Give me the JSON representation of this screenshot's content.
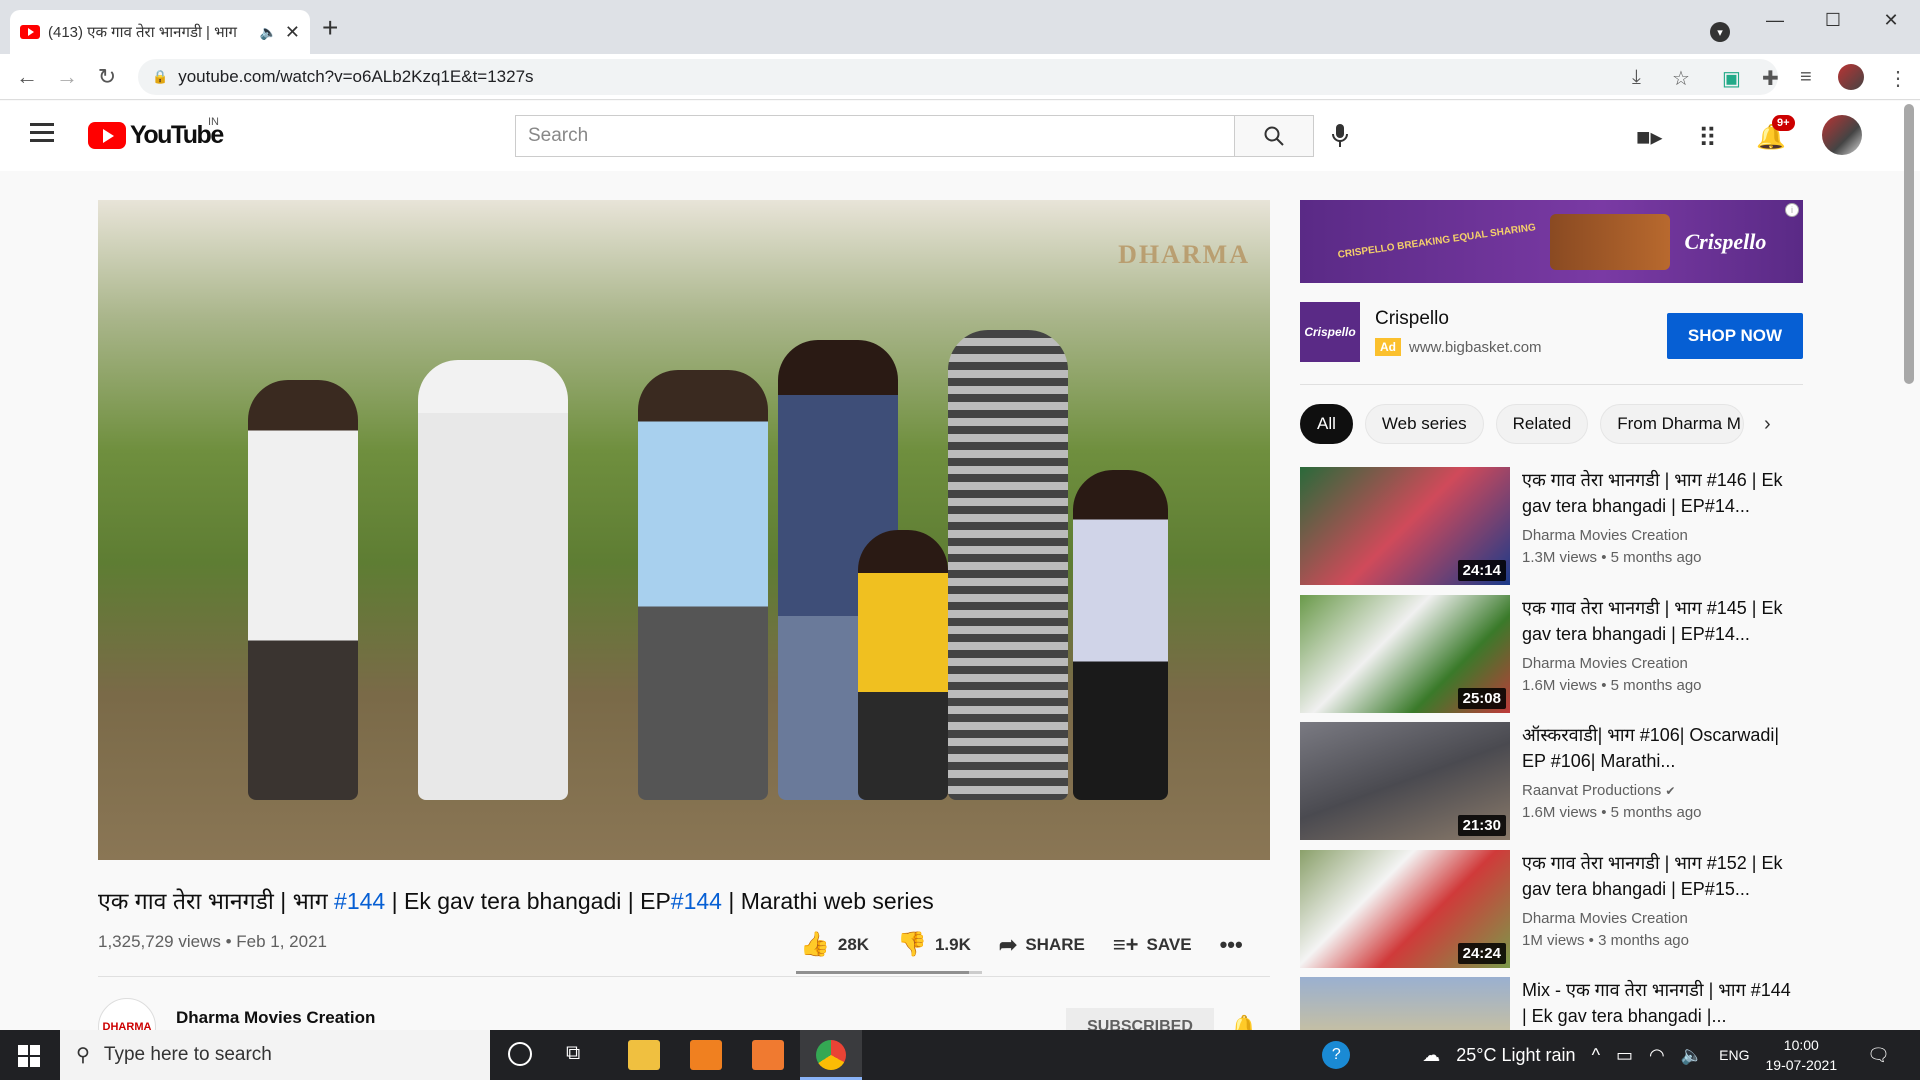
{
  "browser": {
    "tab_title": "(413) एक गाव तेरा भानगडी | भाग",
    "new_tab": "+",
    "url": "youtube.com/watch?v=o6ALb2Kzq1E&t=1327s"
  },
  "header": {
    "logo_text": "YouTube",
    "country_code": "IN",
    "search_placeholder": "Search",
    "notification_count": "9+"
  },
  "video": {
    "title_part1": "एक गाव तेरा भानगडी | भाग ",
    "hashtag1": "#144",
    "title_part2": " | Ek gav tera bhangadi | EP",
    "hashtag2": "#144",
    "title_part3": " | Marathi web series",
    "views_date": "1,325,729 views • Feb 1, 2021",
    "likes": "28K",
    "dislikes": "1.9K",
    "like_ratio": 0.93,
    "share_label": "SHARE",
    "save_label": "SAVE",
    "watermark": "DHARMA",
    "channel_name": "Dharma Movies Creation",
    "channel_logo_text": "DHARMA",
    "subscribe_label": "SUBSCRIBED"
  },
  "ad": {
    "banner_tagline": "CRISPELLO BREAKING EQUAL SHARING",
    "banner_brand": "Crispello",
    "name": "Crispello",
    "tag": "Ad",
    "domain": "www.bigbasket.com",
    "cta": "SHOP NOW",
    "logo_text": "Crispello"
  },
  "chips": [
    "All",
    "Web series",
    "Related",
    "From Dharma M"
  ],
  "related": [
    {
      "title": "एक गाव तेरा भानगडी | भाग #146 | Ek gav tera bhangadi | EP#14...",
      "channel": "Dharma Movies Creation",
      "views": "1.3M views • 5 months ago",
      "duration": "24:14",
      "verified": ""
    },
    {
      "title": "एक गाव तेरा भानगडी | भाग #145 | Ek gav tera bhangadi | EP#14...",
      "channel": "Dharma Movies Creation",
      "views": "1.6M views • 5 months ago",
      "duration": "25:08",
      "verified": ""
    },
    {
      "title": "ऑस्करवाडी| भाग #106| Oscarwadi| EP #106| Marathi...",
      "channel": "Raanvat Productions",
      "views": "1.6M views • 5 months ago",
      "duration": "21:30",
      "verified": "✔"
    },
    {
      "title": "एक गाव तेरा भानगडी | भाग #152 | Ek gav tera bhangadi | EP#15...",
      "channel": "Dharma Movies Creation",
      "views": "1M views • 3 months ago",
      "duration": "24:24",
      "verified": ""
    },
    {
      "title": "Mix - एक गाव तेरा भानगडी | भाग #144 | Ek gav tera bhangadi |...",
      "channel": "",
      "views": "",
      "duration": "",
      "verified": ""
    }
  ],
  "taskbar": {
    "search_placeholder": "Type here to search",
    "weather": "25°C  Light rain",
    "lang": "ENG",
    "time": "10:00",
    "date": "19-07-2021"
  },
  "colors": {
    "brand_red": "#ff0000",
    "link_blue": "#065fd4",
    "ad_purple": "#5a2a86"
  }
}
